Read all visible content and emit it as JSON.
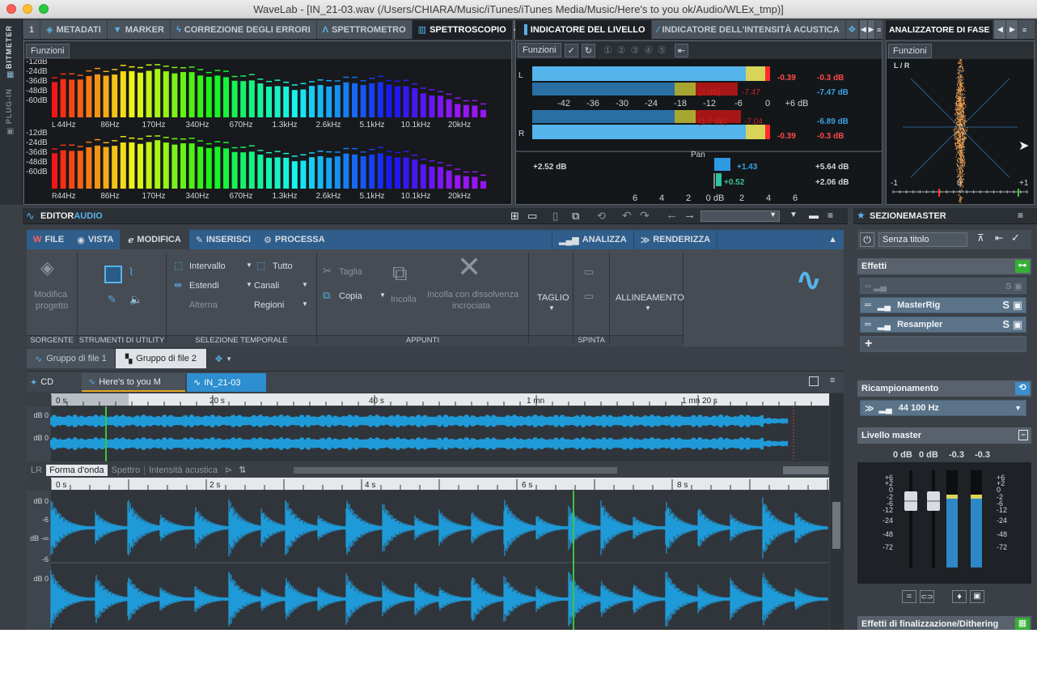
{
  "window": {
    "title": "WaveLab - [IN_21-03.wav (/Users/CHIARA/Music/iTunes/iTunes Media/Music/Here's to you ok/Audio/WLEx_tmp)]"
  },
  "side_tabs": [
    "BITMETER",
    "PLUG-IN"
  ],
  "top_tabs_left": [
    "1",
    "METADATI",
    "MARKER",
    "CORREZIONE DEGLI ERRORI",
    "SPETTROMETRO",
    "SPETTROSCOPIO"
  ],
  "top_tabs_mid": [
    "INDICATORE DEL LIVELLO",
    "INDICATORE DELL'INTENSITÀ ACUSTICA"
  ],
  "top_tabs_right": [
    "ANALIZZATORE DI FASE"
  ],
  "funzioni": "Funzioni",
  "spectroscope": {
    "db_labels": [
      "-12dB",
      "-24dB",
      "-36dB",
      "-48dB",
      "-60dB"
    ],
    "freq_labels": [
      "44Hz",
      "86Hz",
      "170Hz",
      "340Hz",
      "670Hz",
      "1.3kHz",
      "2.6kHz",
      "5.1kHz",
      "10.1kHz",
      "20kHz"
    ],
    "channel_top": "L",
    "channel_bottom": "R"
  },
  "level_meter": {
    "ch_l": "L",
    "ch_r": "R",
    "scale": [
      "-42",
      "-36",
      "-30",
      "-24",
      "-18",
      "-12",
      "-6",
      "0",
      "+6 dB"
    ],
    "l_peak": "-0.39",
    "l_peak_max": "-0.3 dB",
    "l_rms_box": "[2 dB]",
    "l_rms": "-7.47",
    "l_rms_max": "-7.47 dB",
    "r_rms_box": "[1.7 dB]",
    "r_rms": "-7.04",
    "r_rms_max": "-6.89 dB",
    "r_peak": "-0.39",
    "r_peak_max": "-0.3 dB",
    "pan_label": "Pan",
    "pan_left": "+2.52 dB",
    "pan_val1": "+1.43",
    "pan_max1": "+5.64 dB",
    "pan_val2": "+0.52",
    "pan_max2": "+2.06 dB",
    "pan_scale": [
      "6",
      "4",
      "2",
      "0 dB",
      "2",
      "4",
      "6"
    ]
  },
  "phase": {
    "label": "L / R",
    "scale": [
      "-1",
      "0",
      "+1"
    ]
  },
  "editor": {
    "title_a": "EDITOR",
    "title_b": "AUDIO",
    "menu": [
      "FILE",
      "VISTA",
      "MODIFICA",
      "INSERISCI",
      "PROCESSA"
    ],
    "menu_right": [
      "ANALIZZA",
      "RENDERIZZA"
    ],
    "ribbon": {
      "modifica_progetto": [
        "Modifica",
        "progetto"
      ],
      "intervallo": "Intervallo",
      "tutto": "Tutto",
      "estendi": "Estendi",
      "canali": "Canali",
      "alterna": "Alterna",
      "regioni": "Regioni",
      "taglia": "Taglia",
      "copia": "Copia",
      "incolla": "Incolla",
      "incolla_dissolv": [
        "Incolla con dissolvenza",
        "incrociata"
      ],
      "taglio": "TAGLIO",
      "allineamento": "ALLINEAMENTO",
      "groups": [
        "SORGENTE",
        "STRUMENTI DI UTILITY",
        "SELEZIONE TEMPORALE",
        "APPUNTI",
        "SPINTA"
      ]
    },
    "file_groups": [
      "Gruppo di file 1",
      "Gruppo di file 2"
    ],
    "file_tabs": [
      "CD",
      "Here's to you M",
      "IN_21-03"
    ],
    "overview_times": [
      "0 s",
      "20 s",
      "40 s",
      "1 mn",
      "1 mn 20 s"
    ],
    "view_tabs": [
      "LR",
      "Forma d'onda",
      "Spettro",
      "Intensità acustica"
    ],
    "main_times": [
      "0 s",
      "2 s",
      "4 s",
      "6 s",
      "8 s"
    ],
    "db_ticks": [
      "dB 0",
      "-6",
      "dB -∞",
      "-6",
      "dB 0"
    ]
  },
  "master": {
    "title_a": "SEZIONE",
    "title_b": "MASTER",
    "preset": "Senza titolo",
    "effetti": "Effetti",
    "plugins": [
      "MasterRig",
      "Resampler"
    ],
    "ricampionamento": "Ricampionamento",
    "sample_rate": "44 100 Hz",
    "livello_master": "Livello master",
    "levels": [
      "0 dB",
      "0 dB",
      "-0.3",
      "-0.3"
    ],
    "scale": [
      "+6",
      "+2",
      "0",
      "-2",
      "-6",
      "-12",
      "-24",
      "-48",
      "-72"
    ],
    "finalizzazione": "Effetti di finalizzazione/Dithering"
  },
  "colors": {
    "accent": "#35a8e6",
    "waveform": "#1f9ad8",
    "green": "#3ec43e",
    "red": "#ff3030"
  }
}
